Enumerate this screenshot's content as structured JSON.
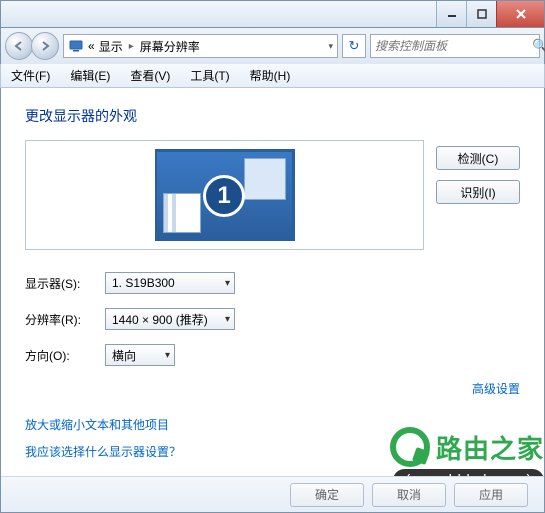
{
  "titlebar": {},
  "nav": {
    "crumb_sep": "«",
    "crumb1": "显示",
    "crumb2": "屏幕分辨率",
    "search_placeholder": "搜索控制面板"
  },
  "menu": {
    "file": "文件(F)",
    "edit": "编辑(E)",
    "view": "查看(V)",
    "tools": "工具(T)",
    "help": "帮助(H)"
  },
  "content": {
    "heading": "更改显示器的外观",
    "monitor_number": "1",
    "detect_btn": "检测(C)",
    "identify_btn": "识别(I)",
    "display_label": "显示器(S):",
    "display_value": "1. S19B300",
    "resolution_label": "分辨率(R):",
    "resolution_value": "1440 × 900 (推荐)",
    "orientation_label": "方向(O):",
    "orientation_value": "横向",
    "advanced_link": "高级设置",
    "link_text_size": "放大或缩小文本和其他项目",
    "link_which_display": "我应该选择什么显示器设置？"
  },
  "buttons": {
    "ok": "确定",
    "cancel": "取消",
    "apply": "应用"
  },
  "watermark": {
    "brand": "路由之家",
    "url": "(www.hhhyh.com)"
  }
}
